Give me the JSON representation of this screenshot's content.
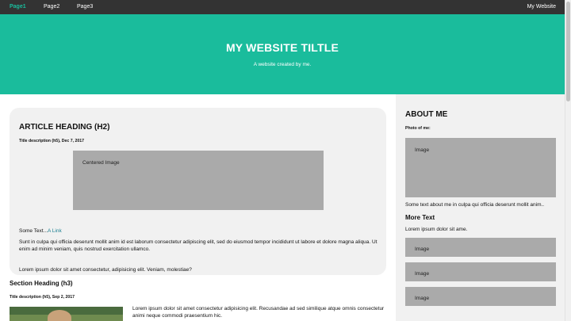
{
  "nav": {
    "links": [
      "Page1",
      "Page2",
      "Page3"
    ],
    "right_link": "My Website"
  },
  "header": {
    "title": "MY WEBSITE TILTLE",
    "subtitle": "A website created by me."
  },
  "article": {
    "heading": "ARTICLE HEADING (H2)",
    "title_desc": "Title description (h5), Dec 7, 2017",
    "image_label": "Centered Image",
    "some_text": "Some Text...",
    "link_text": "A Link",
    "paragraph1": "Sunt in culpa qui officia deserunt mollit anim id est laborum consectetur adipiscing elit, sed do eiusmod tempor incididunt ut labore et dolore magna aliqua. Ut enim ad minim veniam, quis nostrud exercitation ullamco.",
    "paragraph2": "Lorem ipsum dolor sit amet consectetur, adipisicing elit. Veniam, molestiae?"
  },
  "section": {
    "heading": "Section Heading (h3)",
    "title_desc": "Title description (h5), Sep 2, 2017",
    "paragraph": "Lorem ipsum dolor sit amet consectetur adipisicing elit. Recusandae ad sed similique atque omnis consectetur animi neque commodi praesentium hic."
  },
  "sidebar": {
    "heading": "ABOUT ME",
    "photo_label": "Photo of me:",
    "image_label": "Image",
    "about_text": "Some text about me in culpa qui officia deserunt mollit anim..",
    "more_heading": "More Text",
    "more_paragraph": "Lorem ipsum dolor sit ame.",
    "small_images": [
      "Image",
      "Image",
      "Image"
    ]
  },
  "colors": {
    "nav_bg": "#333333",
    "accent": "#1abc9c",
    "panel_bg": "#f1f1f1",
    "placeholder": "#aaaaaa",
    "link": "#1a7f91"
  }
}
